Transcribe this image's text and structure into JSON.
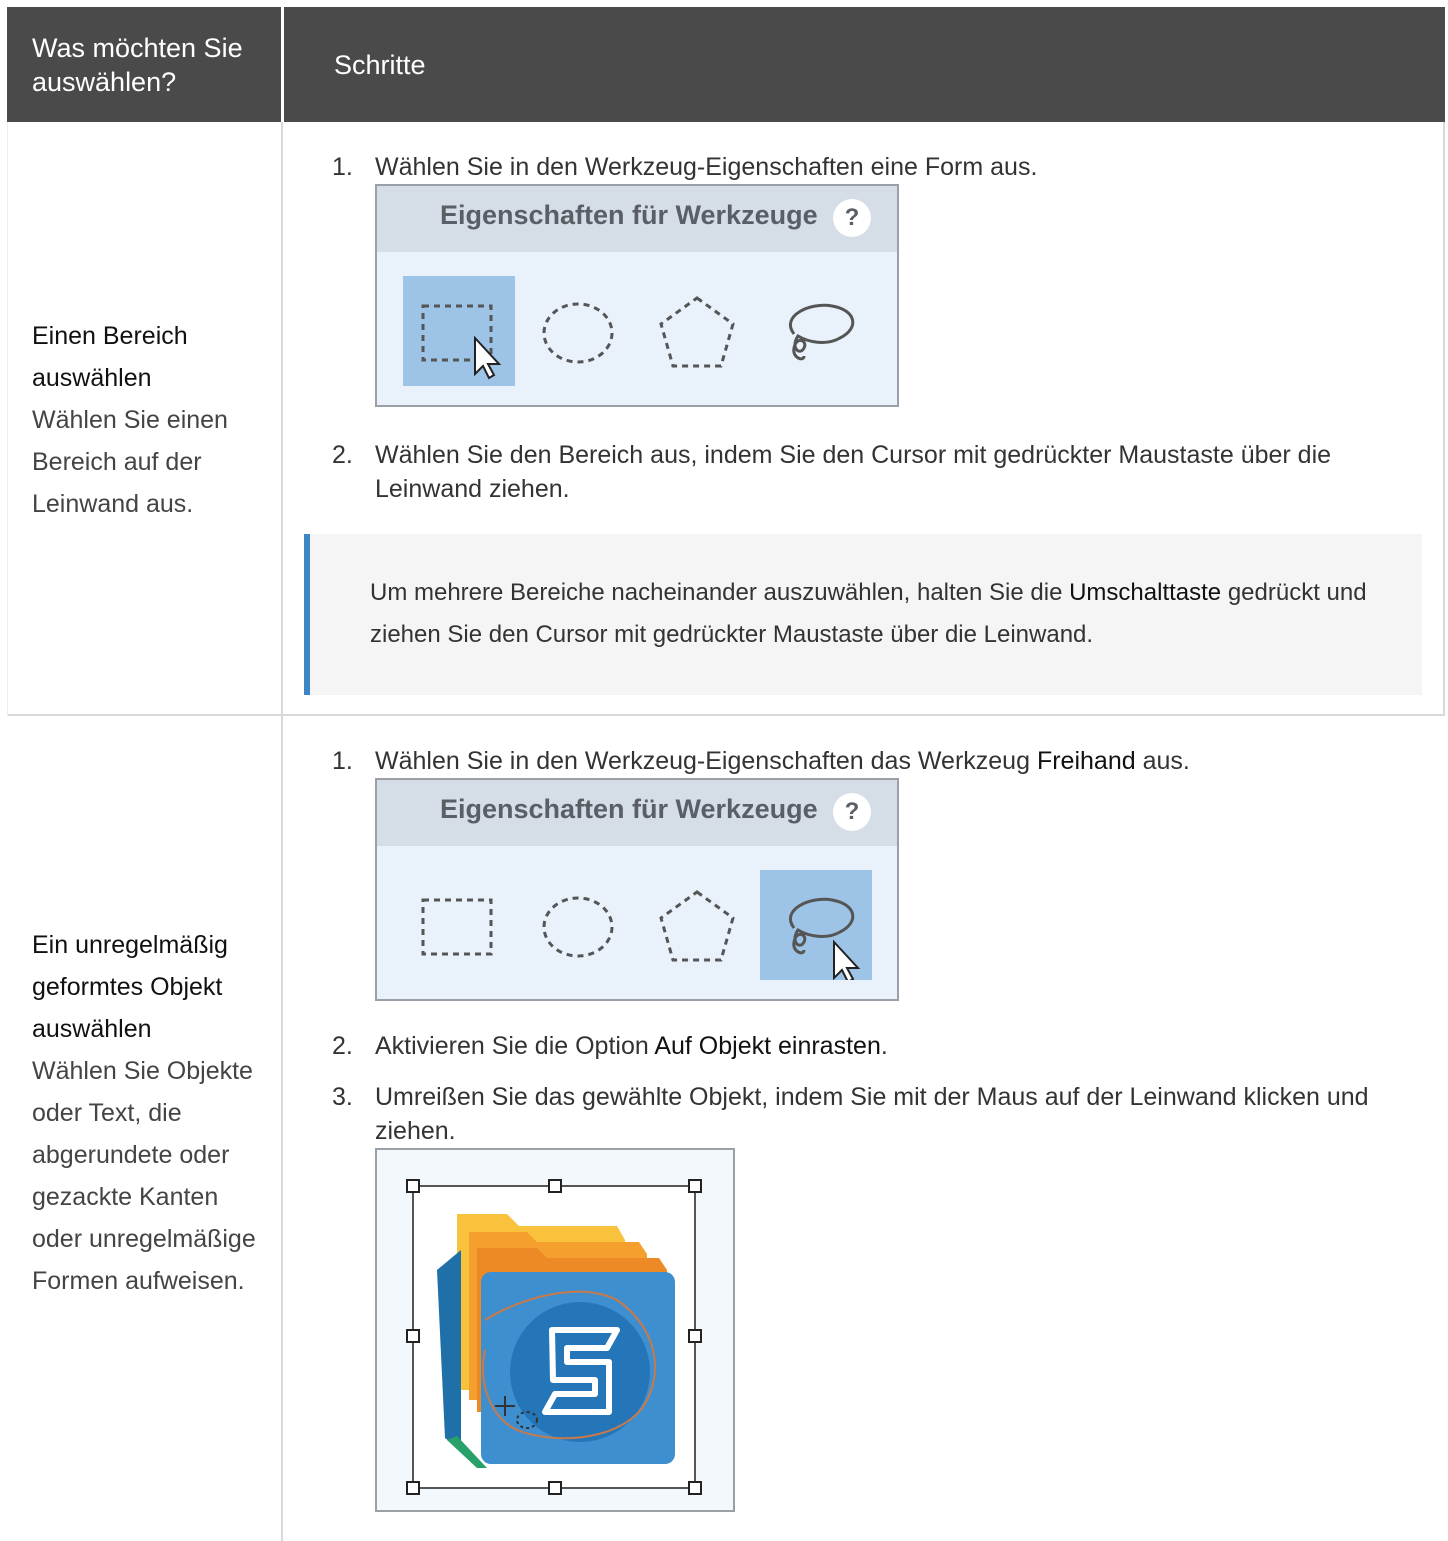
{
  "table": {
    "header": {
      "col1": "Was möchten Sie auswählen?",
      "col2": "Schritte"
    },
    "rows": [
      {
        "title": "Einen Bereich auswählen",
        "description": "Wählen Sie einen Bereich auf der Leinwand aus.",
        "steps": [
          {
            "num": "1.",
            "text": "Wählen Sie in den Werkzeug-Eigenschaften eine Form aus."
          },
          {
            "num": "2.",
            "text": "Wählen Sie den Bereich aus, indem Sie den Cursor mit gedrückter Maustaste über die Leinwand ziehen."
          }
        ],
        "panel": {
          "title": "Eigenschaften für Werkzeuge",
          "help": "?",
          "selected_tool": "rectangle"
        },
        "note": {
          "before": "Um mehrere Bereiche nacheinander auszuwählen, halten Sie die ",
          "bold": "Umschalttaste",
          "after": " gedrückt und ziehen Sie den Cursor mit gedrückter Maustaste über die Leinwand."
        }
      },
      {
        "title": "Ein unregelmäßig geformtes Objekt auswählen",
        "description": "Wählen Sie Objekte oder Text, die abgerundete oder gezackte Kanten oder unregelmäßige Formen aufweisen.",
        "steps": [
          {
            "num": "1.",
            "before": "Wählen Sie in den Werkzeug-Eigenschaften das Werkzeug ",
            "bold": "Freihand",
            "after": " aus."
          },
          {
            "num": "2.",
            "before": "Aktivieren Sie die Option ",
            "bold": "Auf Objekt einrasten",
            "after": "."
          },
          {
            "num": "3.",
            "text": "Umreißen Sie das gewählte Objekt, indem Sie mit der Maus auf der Leinwand klicken und ziehen."
          }
        ],
        "panel": {
          "title": "Eigenschaften für Werkzeuge",
          "help": "?",
          "selected_tool": "freehand"
        }
      }
    ]
  },
  "colors": {
    "header_bg": "#4a4a4a",
    "note_accent": "#3d86c6",
    "tool_selected": "#9dc3e6",
    "logo_blue": "#3e8fd0"
  }
}
